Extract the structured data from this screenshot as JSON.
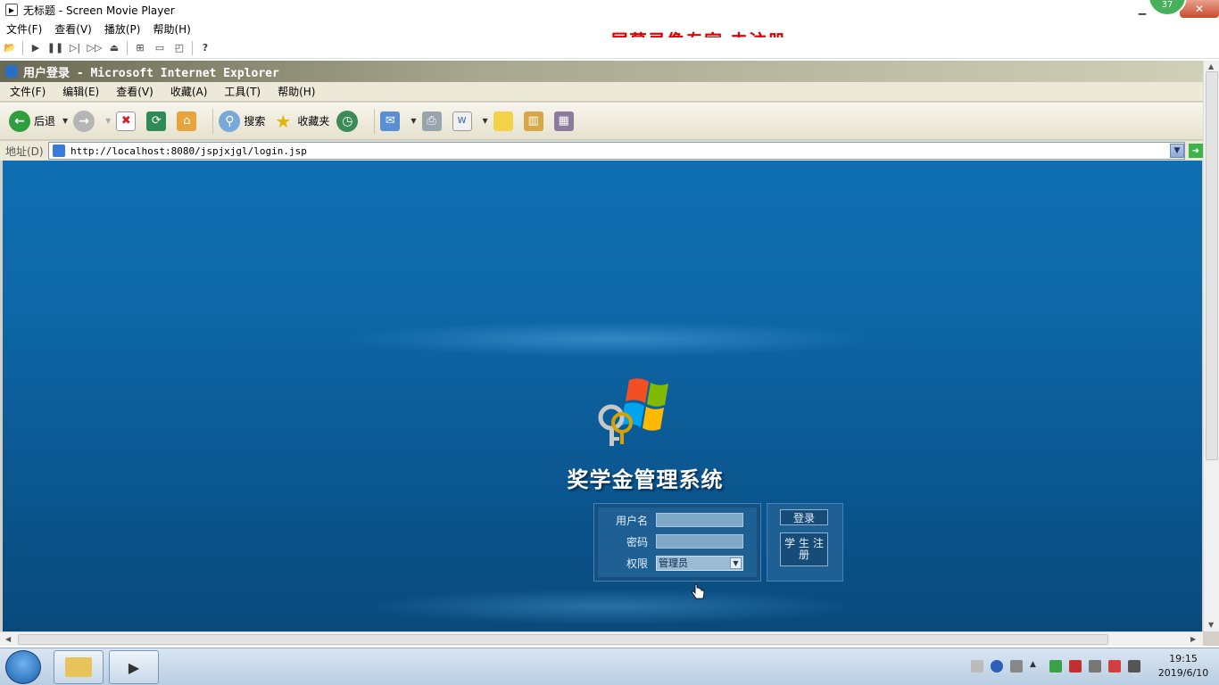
{
  "player": {
    "title": "无标题 - Screen Movie Player",
    "menu": [
      "文件(F)",
      "查看(V)",
      "播放(P)",
      "帮助(H)"
    ],
    "watermark": "屏幕录像专家  未注册",
    "badge": "37"
  },
  "ie": {
    "title": "用户登录 - Microsoft Internet Explorer",
    "menu": [
      "文件(F)",
      "编辑(E)",
      "查看(V)",
      "收藏(A)",
      "工具(T)",
      "帮助(H)"
    ],
    "toolbar": {
      "back": "后退",
      "search": "搜索",
      "favorites": "收藏夹"
    },
    "address": {
      "label": "地址(D)",
      "url": "http://localhost:8080/jspjxjgl/login.jsp"
    }
  },
  "page": {
    "system_title": "奖学金管理系统",
    "username_label": "用户名",
    "username_value": "",
    "password_label": "密码",
    "password_value": "",
    "role_label": "权限",
    "role_selected": "管理员",
    "login_button": "登录",
    "register_button": "学生注册"
  },
  "taskbar": {
    "time": "19:15",
    "date": "2019/6/10"
  }
}
